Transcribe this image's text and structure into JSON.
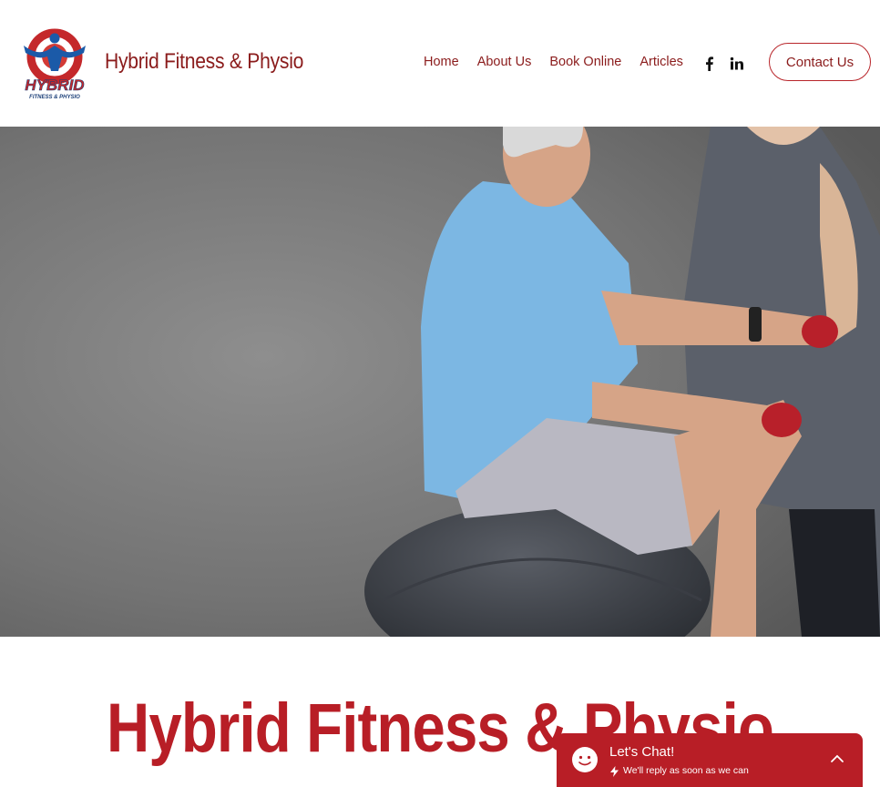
{
  "header": {
    "brand": "Hybrid Fitness & Physio",
    "logo": {
      "main_text": "HYBRID",
      "sub_text": "FITNESS & PHYSIO"
    },
    "nav": [
      "Home",
      "About Us",
      "Book Online",
      "Articles"
    ],
    "social": [
      "facebook-icon",
      "linkedin-icon"
    ],
    "contact_label": "Contact Us"
  },
  "hero": {
    "image": "photo-trainer-assisting-senior-man-on-exercise-ball-with-dumbbells"
  },
  "main": {
    "title": "Hybrid Fitness & Physio"
  },
  "chat": {
    "title": "Let's Chat!",
    "subtitle": "We'll reply as soon as we can"
  },
  "colors": {
    "brand_red": "#b81e26",
    "nav_red": "#8b1c1c",
    "logo_blue": "#1b5aa8"
  }
}
